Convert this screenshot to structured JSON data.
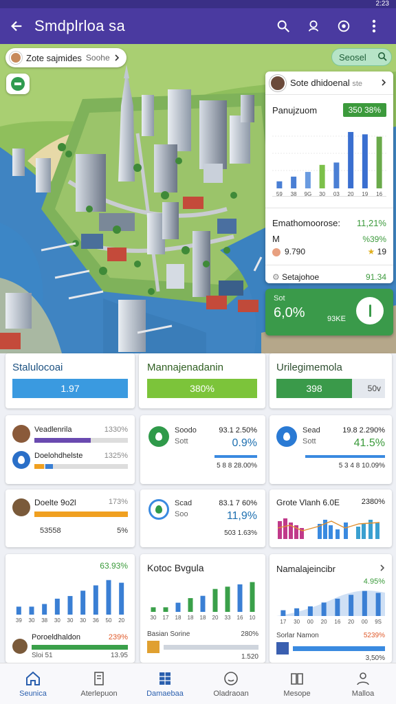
{
  "status": {
    "time": "2:23"
  },
  "appbar": {
    "title": "Smdplrloa sa",
    "icons": [
      "back-arrow-icon",
      "search-icon",
      "user-pin-icon",
      "settings-circle-icon",
      "more-vert-icon"
    ]
  },
  "map": {
    "chip_label": "Zote sajmides",
    "chip_value": "Soohe",
    "search_pill": "Seosel"
  },
  "overlay": {
    "title": "Sote dhidoenal",
    "title_suffix": "ste",
    "row1_label": "Panujzuom",
    "row1_badge": "350 38%",
    "stat_label": "Emathomoorose:",
    "stat_value": "11,21%",
    "m_label": "M",
    "m_value": "%39%",
    "m2_value": "9.790",
    "m2_right": "19",
    "foot_label": "Setajohoe",
    "foot_value": "91.34",
    "chart": {
      "type": "bar",
      "categories": [
        "59",
        "38",
        "9G",
        "30",
        "03",
        "20",
        "19",
        "16"
      ],
      "values": [
        6,
        10,
        14,
        20,
        22,
        48,
        46,
        44
      ],
      "colors": [
        "#4a7fd4",
        "#4a7fd4",
        "#6a9be0",
        "#7cc04a",
        "#4a7fd4",
        "#3a6fd0",
        "#3a6fd0",
        "#6aaa4a"
      ]
    }
  },
  "green_card": {
    "small": "Sot",
    "big": "6,0%",
    "sub": "93KE"
  },
  "tiles": [
    {
      "title": "Stalulocoai",
      "bar": "1.97",
      "color": "#3a9ae0"
    },
    {
      "title": "Mannajenadanin",
      "bar": "380%",
      "color": "#7cc43a"
    },
    {
      "title": "Urilegimemola",
      "bar": "398",
      "right": "50v",
      "color": "#3a9a4a"
    }
  ],
  "row2": {
    "left": {
      "r1_label": "Veadlenrila",
      "r1_value": "1330%",
      "r2_label": "Doelohdhelste",
      "r2_value": "1325%"
    },
    "mid": {
      "label": "Soodo",
      "sub": "Sott",
      "v1": "93.1 2.50%",
      "v2": "0.9%",
      "foot": "5 8 8 28.00%"
    },
    "right": {
      "label": "Sead",
      "sub": "Sott",
      "v1": "19.8 2.290%",
      "v2": "41.5%",
      "foot": "5 3 4 8 10.09%"
    }
  },
  "row3": {
    "left": {
      "label": "Doelte 9o2l",
      "value": "173%",
      "foot": "53558",
      "foot_right": "5%"
    },
    "mid": {
      "label": "Scad",
      "sub": "Soo",
      "v1": "83.1 7 60%",
      "v2": "11,9%",
      "foot": "503 1.63%"
    },
    "right": {
      "label": "Grote Vlanh 6.0E",
      "value": "2380%"
    }
  },
  "row4": {
    "left": {
      "value": "63.93%",
      "labels": [
        "39",
        "30",
        "38",
        "30",
        "30",
        "30",
        "36",
        "50",
        "20"
      ],
      "values": [
        6,
        6,
        8,
        12,
        14,
        18,
        22,
        26,
        24
      ],
      "foot_label": "Poroeldhaldon",
      "foot_value": "239%",
      "foot2": "Sloi 51",
      "foot2_right": "13.95"
    },
    "mid": {
      "title": "Kotoc Bvgula",
      "labels": [
        "30",
        "17",
        "18",
        "18",
        "18",
        "20",
        "33",
        "16",
        "10"
      ],
      "values": [
        4,
        4,
        8,
        12,
        14,
        20,
        22,
        24,
        26
      ],
      "foot_label": "Basian Sorine",
      "foot_value": "280%",
      "foot2_right": "1.520"
    },
    "right": {
      "title": "Namalajeincibr",
      "value": "4.95%",
      "labels": [
        "17",
        "30",
        "00",
        "20",
        "16",
        "20",
        "00",
        "9S"
      ],
      "values": [
        6,
        8,
        10,
        14,
        18,
        22,
        26,
        24
      ],
      "foot_label": "Sorlar Namon",
      "foot_value": "5239%",
      "foot2_right": "3,50%"
    }
  },
  "nav": [
    {
      "label": "Seunica",
      "icon": "home-icon",
      "active": true
    },
    {
      "label": "Aterlepuon",
      "icon": "document-icon",
      "active": false
    },
    {
      "label": "Damaebaa",
      "icon": "grid-book-icon",
      "active": true
    },
    {
      "label": "Oladraoan",
      "icon": "smile-icon",
      "active": false
    },
    {
      "label": "Mesope",
      "icon": "map-book-icon",
      "active": false
    },
    {
      "label": "Malloa",
      "icon": "profile-icon",
      "active": false
    }
  ]
}
